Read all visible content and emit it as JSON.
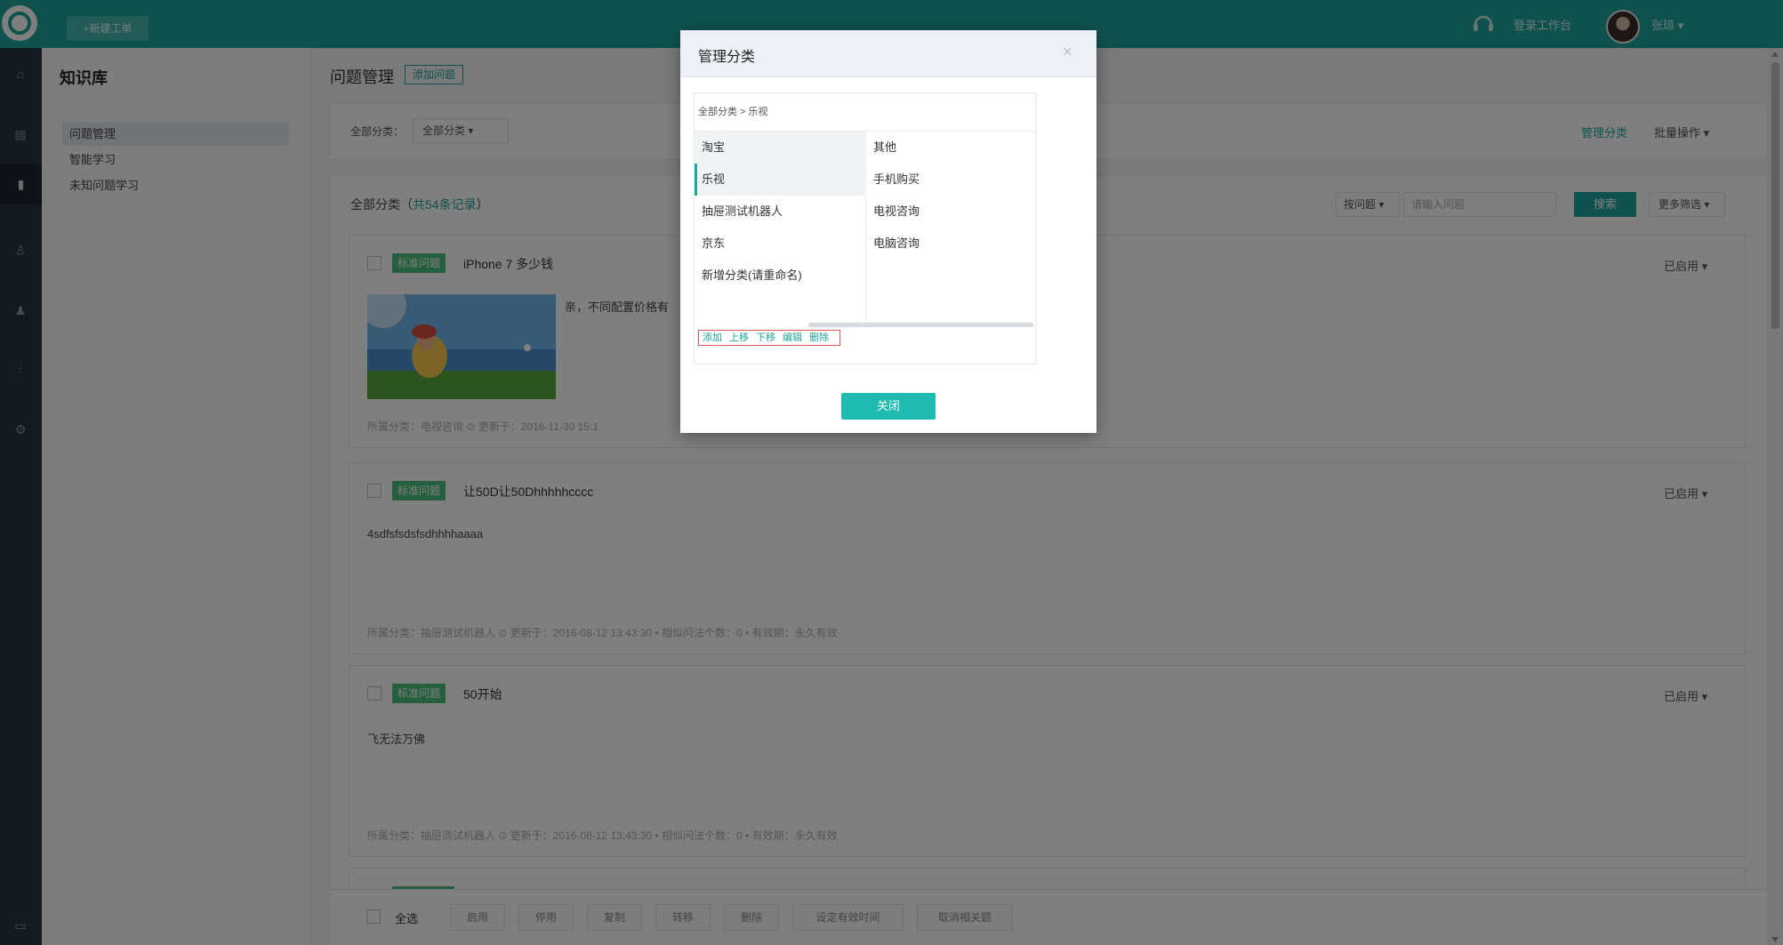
{
  "topbar": {
    "new_ticket": "+新建工单",
    "workbench": "登录工作台",
    "username": "张琼 ▾"
  },
  "leftnav": {
    "icons": [
      "home-icon",
      "grid-icon",
      "book-icon",
      "user-icon",
      "users-icon",
      "chart-icon",
      "gear-icon",
      "chat-icon"
    ]
  },
  "sidebar": {
    "title": "知识库",
    "items": [
      {
        "label": "问题管理",
        "active": true
      },
      {
        "label": "智能学习",
        "active": false
      },
      {
        "label": "未知问题学习",
        "active": false
      }
    ]
  },
  "main": {
    "title": "问题管理",
    "add_button": "添加问题",
    "filter": {
      "label": "全部分类：",
      "select_value": "全部分类 ▾",
      "manage_link": "管理分类",
      "batch_label": "批量操作 ▾"
    },
    "list": {
      "summary_prefix": "全部分类（",
      "summary_count_text": "共54条记录",
      "summary_suffix": "）",
      "ask_select": "按问题 ▾",
      "search_placeholder": "请输入问题",
      "search_button": "搜索",
      "more_filter": "更多筛选 ▾"
    },
    "questions": [
      {
        "tag": "标准问题",
        "title": "iPhone 7 多少钱",
        "status": "已启用 ▾",
        "answer": "亲，不同配置价格有",
        "meta": "所属分类：电视咨询   ⊙ 更新于：2016-11-30 15:1",
        "has_image": true
      },
      {
        "tag": "标准问题",
        "title": "让50D让50Dhhhhhcccc",
        "status": "已启用 ▾",
        "answer": "4sdfsfsdsfsdhhhhaaaa",
        "meta": "所属分类：抽屉测试机器人   ⊙ 更新于：2016-08-12 13:43:30   • 相似问法个数：0   • 有效期：永久有效",
        "has_image": false
      },
      {
        "tag": "标准问题",
        "title": "50开始",
        "status": "已启用 ▾",
        "answer": "飞无法万佛",
        "meta": "所属分类：抽屉测试机器人   ⊙ 更新于：2016-08-12 13:43:30   • 相似问法个数：0   • 有效期：永久有效",
        "has_image": false
      }
    ],
    "bottom": {
      "select_all": "全选",
      "buttons": [
        "启用",
        "停用",
        "复制",
        "转移",
        "删除",
        "设定有效时间",
        "取消相关题"
      ]
    }
  },
  "modal": {
    "title": "管理分类",
    "close_symbol": "×",
    "breadcrumb": "全部分类 > 乐视",
    "categories": [
      {
        "label": "淘宝",
        "state": "hl"
      },
      {
        "label": "乐视",
        "state": "sel"
      },
      {
        "label": "抽屉测试机器人",
        "state": ""
      },
      {
        "label": "京东",
        "state": ""
      },
      {
        "label": "新增分类(请重命名)",
        "state": ""
      }
    ],
    "subcategories": [
      "其他",
      "手机购买",
      "电视咨询",
      "电脑咨询"
    ],
    "actions": [
      "添加",
      "上移",
      "下移",
      "编辑",
      "删除"
    ],
    "close_button": "关闭"
  },
  "colors": {
    "brand": "#1fa59a",
    "tag_green": "#4bbf7a",
    "nav_dark": "#2a3340",
    "highlight_border": "#e45555"
  }
}
